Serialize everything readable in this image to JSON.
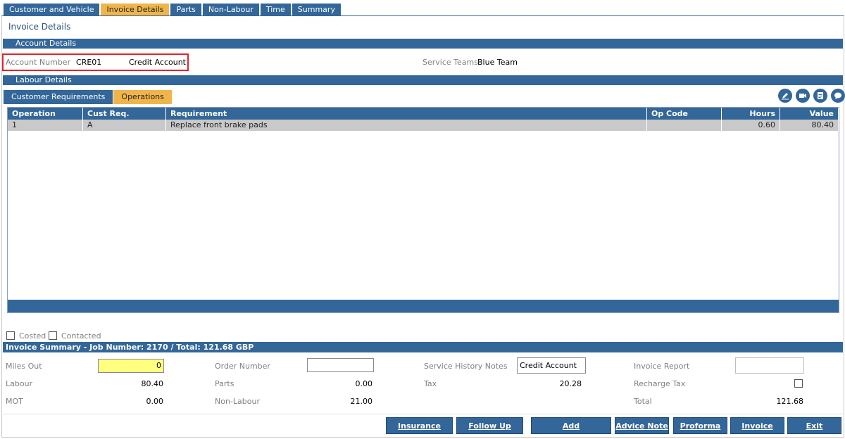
{
  "tabs": [
    "Customer and Vehicle",
    "Invoice Details",
    "Parts",
    "Non-Labour",
    "Time",
    "Summary"
  ],
  "page_title": "Invoice Details",
  "sections": {
    "account_details": "Account Details",
    "labour_details": "Labour Details"
  },
  "account": {
    "number_label": "Account Number",
    "number": "CRE01",
    "type": "Credit Account",
    "service_teams_label": "Service Teams",
    "service_team": "Blue Team"
  },
  "labour_tabs": [
    "Customer Requirements",
    "Operations"
  ],
  "toolbar_icons": [
    "edit-icon",
    "video-icon",
    "document-icon",
    "chat-icon"
  ],
  "grid": {
    "columns": [
      "Operation",
      "Cust Req.",
      "Requirement",
      "Op Code",
      "Hours",
      "Value"
    ],
    "rows": [
      [
        "1",
        "A",
        "Replace front brake pads",
        "",
        "0.60",
        "80.40"
      ]
    ]
  },
  "flags": {
    "costed": "Costed",
    "contacted": "Contacted"
  },
  "summary": {
    "title": "Invoice Summary - Job Number: 2170 / Total: 121.68 GBP",
    "miles_out_label": "Miles Out",
    "miles_out": "0",
    "labour_label": "Labour",
    "labour": "80.40",
    "mot_label": "MOT",
    "mot": "0.00",
    "order_number_label": "Order Number",
    "order_number": "",
    "parts_label": "Parts",
    "parts": "0.00",
    "non_labour_label": "Non-Labour",
    "non_labour": "21.00",
    "service_history_notes_label": "Service History Notes",
    "service_history_notes": "Credit Account",
    "tax_label": "Tax",
    "tax": "20.28",
    "invoice_report_label": "Invoice Report",
    "invoice_report": "",
    "recharge_tax_label": "Recharge Tax",
    "total_label": "Total",
    "total": "121.68"
  },
  "buttons": {
    "insurance_excess": "Insurance Excess",
    "follow_up": "Follow Up",
    "add": "Add",
    "advice_note": "Advice Note",
    "proforma": "Proforma",
    "invoice": "Invoice",
    "exit": "Exit"
  },
  "colors": {
    "primary": "#336699",
    "accent": "#f0b54a",
    "highlight": "#e0242a",
    "input_highlight": "#ffff80"
  }
}
